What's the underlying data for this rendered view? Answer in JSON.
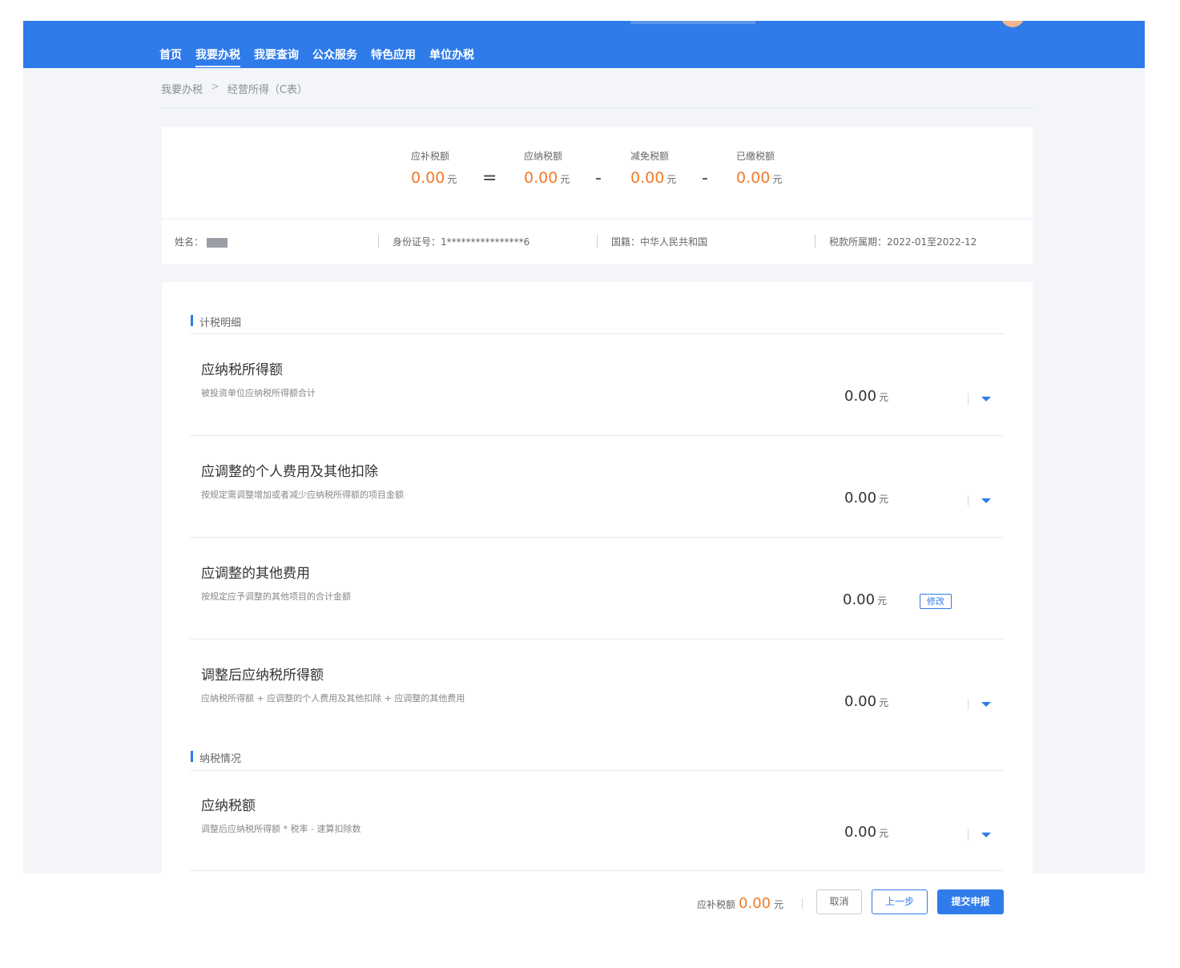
{
  "nav": {
    "items": [
      {
        "label": "首页"
      },
      {
        "label": "我要办税"
      },
      {
        "label": "我要查询"
      },
      {
        "label": "公众服务"
      },
      {
        "label": "特色应用"
      },
      {
        "label": "单位办税"
      }
    ],
    "active": "我要办税"
  },
  "breadcrumb": {
    "parent": "我要办税",
    "separator": ">",
    "current": "经营所得（C表）"
  },
  "summary": {
    "unit": "元",
    "items": [
      {
        "label": "应补税额",
        "value": "0.00"
      },
      {
        "label": "应纳税额",
        "value": "0.00"
      },
      {
        "label": "减免税额",
        "value": "0.00"
      },
      {
        "label": "已缴税额",
        "value": "0.00"
      }
    ],
    "operators": [
      "=",
      "-",
      "-"
    ]
  },
  "info": {
    "name_label": "姓名：",
    "id_label": "身份证号：",
    "id_value": "1****************6",
    "nationality_label": "国籍：",
    "nationality_value": "中华人民共和国",
    "period_label": "税款所属期：",
    "period_value": "2022-01至2022-12"
  },
  "sections": {
    "detail_title": "计税明细",
    "status_title": "纳税情况"
  },
  "rows": [
    {
      "title": "应纳税所得额",
      "desc": "被投资单位应纳税所得额合计",
      "value": "0.00",
      "unit": "元",
      "action": "caret"
    },
    {
      "title": "应调整的个人费用及其他扣除",
      "desc": "按规定需调整增加或者减少应纳税所得额的项目金额",
      "value": "0.00",
      "unit": "元",
      "action": "caret"
    },
    {
      "title": "应调整的其他费用",
      "desc": "按规定应予调整的其他项目的合计金额",
      "value": "0.00",
      "unit": "元",
      "action": "edit",
      "edit_label": "修改"
    },
    {
      "title": "调整后应纳税所得额",
      "desc": "应纳税所得额 + 应调整的个人费用及其他扣除 + 应调整的其他费用",
      "value": "0.00",
      "unit": "元",
      "action": "caret"
    },
    {
      "title": "应纳税额",
      "desc": "调整后应纳税所得额 * 税率 - 速算扣除数",
      "value": "0.00",
      "unit": "元",
      "action": "caret"
    }
  ],
  "footer": {
    "label": "应补税额",
    "amount": "0.00",
    "unit": "元",
    "cancel_label": "取消",
    "prev_label": "上一步",
    "submit_label": "提交申报"
  },
  "colors": {
    "primary": "#2f7bea",
    "accent_orange": "#f07a2a",
    "page_bg": "#f3f5f8"
  }
}
